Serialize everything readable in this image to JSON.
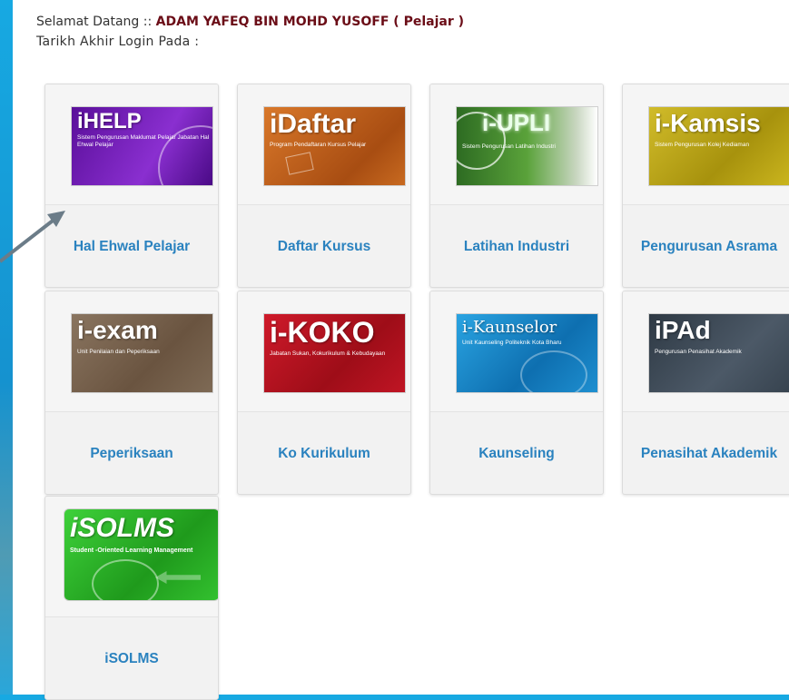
{
  "header": {
    "welcome_prefix": "Selamat Datang :: ",
    "user_name": "ADAM YAFEQ BIN MOHD YUSOFF ( Pelajar )",
    "last_login_label": "Tarikh Akhir Login Pada :"
  },
  "tiles": [
    {
      "label": "Hal Ehwal Pelajar",
      "logo_title": "iHELP",
      "logo_sub": "Sistem Pengurusan Maklumat Pelajar Jabatan Hal Ehwal Pelajar",
      "color": "#6a1fb5",
      "icon": "ihelp-logo-icon"
    },
    {
      "label": "Daftar Kursus",
      "logo_title": "iDaftar",
      "logo_sub": "Program Pendaftaran Kursus Pelajar",
      "color": "#c8661e",
      "icon": "idaftar-logo-icon"
    },
    {
      "label": "Latihan Industri",
      "logo_title": "i-UPLI",
      "logo_sub": "Sistem Pengurusan Latihan Industri",
      "color": "#3f8a2e",
      "icon": "iupli-logo-icon"
    },
    {
      "label": "Pengurusan Asrama",
      "logo_title": "i-Kamsis",
      "logo_sub": "Sistem Pengurusan Kolej Kediaman",
      "color": "#b9a414",
      "icon": "ikamsis-logo-icon"
    },
    {
      "label": "Peperiksaan",
      "logo_title": "i-exam",
      "logo_sub": "Unit Penilaian dan Peperiksaan",
      "color": "#7a6650",
      "icon": "iexam-logo-icon"
    },
    {
      "label": "Ko Kurikulum",
      "logo_title": "i-KOKO",
      "logo_sub": "Jabatan Sukan, Kokurikulum & Kebudayaan",
      "color": "#b5121f",
      "icon": "ikoko-logo-icon"
    },
    {
      "label": "Kaunseling",
      "logo_title": "i-Kaunselor",
      "logo_sub": "Unit Kaunseling Politeknik Kota Bharu",
      "color": "#1f8fd0",
      "icon": "ikaunselor-logo-icon"
    },
    {
      "label": "Penasihat Akademik",
      "logo_title": "iPAd",
      "logo_sub": "Pengurusan Penasihat Akademik",
      "color": "#3d4a57",
      "icon": "ipad-logo-icon"
    },
    {
      "label": "iSOLMS",
      "logo_title": "iSOLMS",
      "logo_sub": "Student -Oriented Learning Management",
      "color": "#2fb52a",
      "icon": "isolms-logo-icon"
    }
  ]
}
